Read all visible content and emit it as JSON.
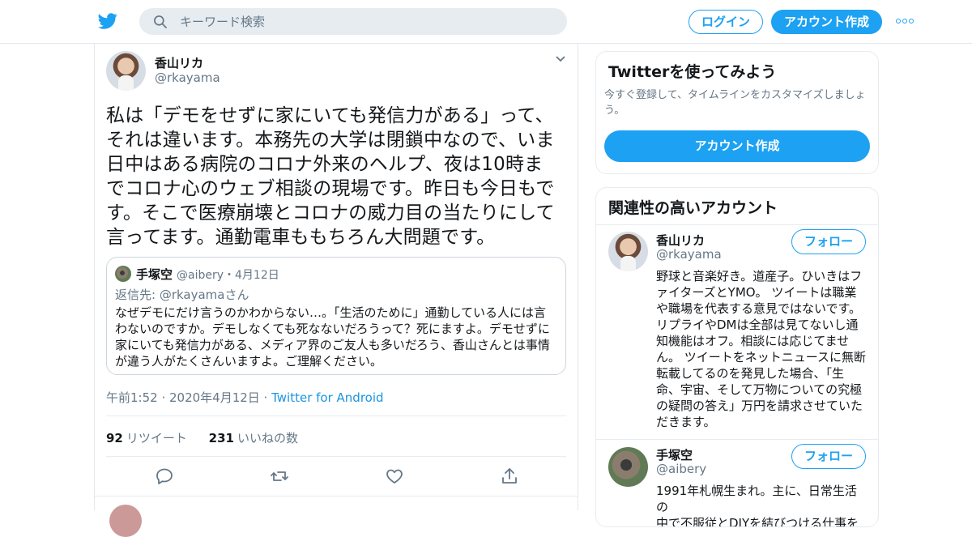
{
  "header": {
    "search_placeholder": "キーワード検索",
    "login_label": "ログイン",
    "signup_label": "アカウント作成"
  },
  "tweet": {
    "author_name": "香山リカ",
    "author_handle": "@rkayama",
    "text_lines": [
      "私は「デモをせずに家にいても発信力がある」って、",
      "それは違います。本務先の大学は閉鎖中なので、いま",
      "日中はある病院のコロナ外来のヘルプ、夜は10時ま",
      "でコロナ心のウェブ相談の現場です。昨日も今日もで",
      "す。そこで医療崩壊とコロナの威力目の当たりにして",
      "言ってます。通勤電車ももちろん大問題です。"
    ],
    "quote": {
      "name": "手塚空",
      "handle_date": "@aibery・4月12日",
      "reply_prefix": "返信先: ",
      "reply_to": "@rkayamaさん",
      "text_lines": [
        "なぜデモにだけ言うのかわからない…。「生活のために」通勤している人には言",
        "わないのですか。デモしなくても死なないだろうって？死にますよ。デモせずに",
        "家にいても発信力がある、メディア界のご友人も多いだろう、香山さんとは事情",
        "が違う人がたくさんいますよ。ご理解ください。"
      ]
    },
    "timestamp": "午前1:52 · 2020年4月12日 · ",
    "source": "Twitter for Android",
    "retweet_count": "92",
    "retweet_label": "リツイート",
    "like_count": "231",
    "like_label": "いいねの数"
  },
  "sidebar": {
    "signup_card": {
      "title": "Twitterを使ってみよう",
      "description_lines": [
        "今すぐ登録して、タイムラインをカスタマイズしましょ",
        "う。"
      ],
      "cta": "アカウント作成"
    },
    "related": {
      "title": "関連性の高いアカウント",
      "follow_label": "フォロー",
      "accounts": [
        {
          "name": "香山リカ",
          "handle": "@rkayama",
          "bio_lines": [
            "野球と音楽好き。道産子。ひいきはフ",
            "ァイターズとYMO。 ツイートは職業",
            "や職場を代表する意見ではないです。",
            "リプライやDMは全部は見てないし通",
            "知機能はオフ。相談には応じてませ",
            "ん。 ツイートをネットニュースに無断",
            "転載してるのを発見した場合、「生",
            "命、宇宙、そして万物についての究極",
            "の疑問の答え」万円を請求させていた",
            "だきます。"
          ]
        },
        {
          "name": "手塚空",
          "handle": "@aibery",
          "bio_lines": [
            "1991年札幌生まれ。主に、日常生活の",
            "中で不服従とDIYを結びつける仕事を"
          ]
        }
      ]
    }
  },
  "colors": {
    "accent": "#1da1f2",
    "text": "#14171a",
    "muted": "#657786",
    "border": "#e6ecf0"
  },
  "icons": [
    "twitter-bird-icon",
    "search-icon",
    "more-dots-icon",
    "chevron-down-icon",
    "reply-icon",
    "retweet-icon",
    "like-icon",
    "share-icon"
  ]
}
